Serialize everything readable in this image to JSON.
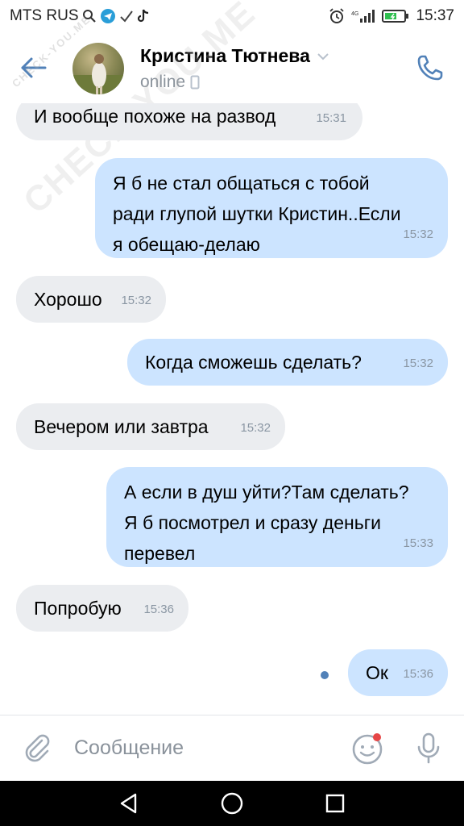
{
  "status_bar": {
    "carrier": "MTS RUS",
    "time": "15:37"
  },
  "header": {
    "contact_name": "Кристина Тютнева",
    "status": "online"
  },
  "watermark": {
    "text": "CHECK-YOU.ME",
    "small_text": "CHECK-YOU.ME"
  },
  "messages": [
    {
      "direction": "in",
      "lines": [
        "И вообще похоже на развод"
      ],
      "time": "15:31"
    },
    {
      "direction": "out",
      "lines": [
        "Я б не стал общаться с тобой",
        "ради глупой шутки Кристин..Если",
        "я обещаю-делаю"
      ],
      "time": "15:32"
    },
    {
      "direction": "in",
      "lines": [
        "Хорошо"
      ],
      "time": "15:32"
    },
    {
      "direction": "out",
      "lines": [
        "Когда сможешь сделать?"
      ],
      "time": "15:32"
    },
    {
      "direction": "in",
      "lines": [
        "Вечером или завтра"
      ],
      "time": "15:32"
    },
    {
      "direction": "out",
      "lines": [
        "А если в душ уйти?Там сделать?",
        "Я б посмотрел и сразу деньги",
        "перевел"
      ],
      "time": "15:33"
    },
    {
      "direction": "in",
      "lines": [
        "Попробую"
      ],
      "time": "15:36"
    },
    {
      "direction": "out",
      "lines": [
        "Ок"
      ],
      "time": "15:36",
      "unread": true
    }
  ],
  "composer": {
    "placeholder": "Сообщение"
  },
  "colors": {
    "accent": "#5181b8",
    "incoming_bubble": "#ebedf0",
    "outgoing_bubble": "#cce4ff",
    "secondary_text": "#8a929b"
  },
  "icons": {
    "back": "arrow-left-icon",
    "phone": "phone-icon",
    "attach": "paperclip-icon",
    "emoji": "smile-icon",
    "mic": "microphone-icon",
    "nav_back": "triangle-back-icon",
    "nav_home": "circle-home-icon",
    "nav_recent": "square-recent-icon"
  }
}
